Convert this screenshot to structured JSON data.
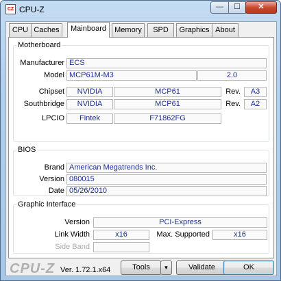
{
  "window": {
    "title": "CPU-Z",
    "icon": "cpuz-app-icon",
    "controls": {
      "minimize": "—",
      "maximize": "☐",
      "close": "✕"
    }
  },
  "tabs": [
    "CPU",
    "Caches",
    "Mainboard",
    "Memory",
    "SPD",
    "Graphics",
    "About"
  ],
  "active_tab": "Mainboard",
  "motherboard": {
    "legend": "Motherboard",
    "manufacturer_label": "Manufacturer",
    "manufacturer": "ECS",
    "model_label": "Model",
    "model": "MCP61M-M3",
    "model_rev": "2.0",
    "chipset_label": "Chipset",
    "chipset_vendor": "NVIDIA",
    "chipset_name": "MCP61",
    "chipset_rev_label": "Rev.",
    "chipset_rev": "A3",
    "southbridge_label": "Southbridge",
    "southbridge_vendor": "NVIDIA",
    "southbridge_name": "MCP61",
    "southbridge_rev_label": "Rev.",
    "southbridge_rev": "A2",
    "lpcio_label": "LPCIO",
    "lpcio_vendor": "Fintek",
    "lpcio_name": "F71862FG"
  },
  "bios": {
    "legend": "BIOS",
    "brand_label": "Brand",
    "brand": "American Megatrends Inc.",
    "version_label": "Version",
    "version": "080015",
    "date_label": "Date",
    "date": "05/26/2010"
  },
  "graphic": {
    "legend": "Graphic Interface",
    "version_label": "Version",
    "version": "PCI-Express",
    "link_width_label": "Link Width",
    "link_width": "x16",
    "max_supported_label": "Max. Supported",
    "max_supported": "x16",
    "side_band_label": "Side Band",
    "side_band": ""
  },
  "bottom": {
    "logo": "CPU-Z",
    "version": "Ver. 1.72.1.x64",
    "tools": "Tools",
    "tools_arrow": "▼",
    "validate": "Validate",
    "ok": "OK"
  }
}
